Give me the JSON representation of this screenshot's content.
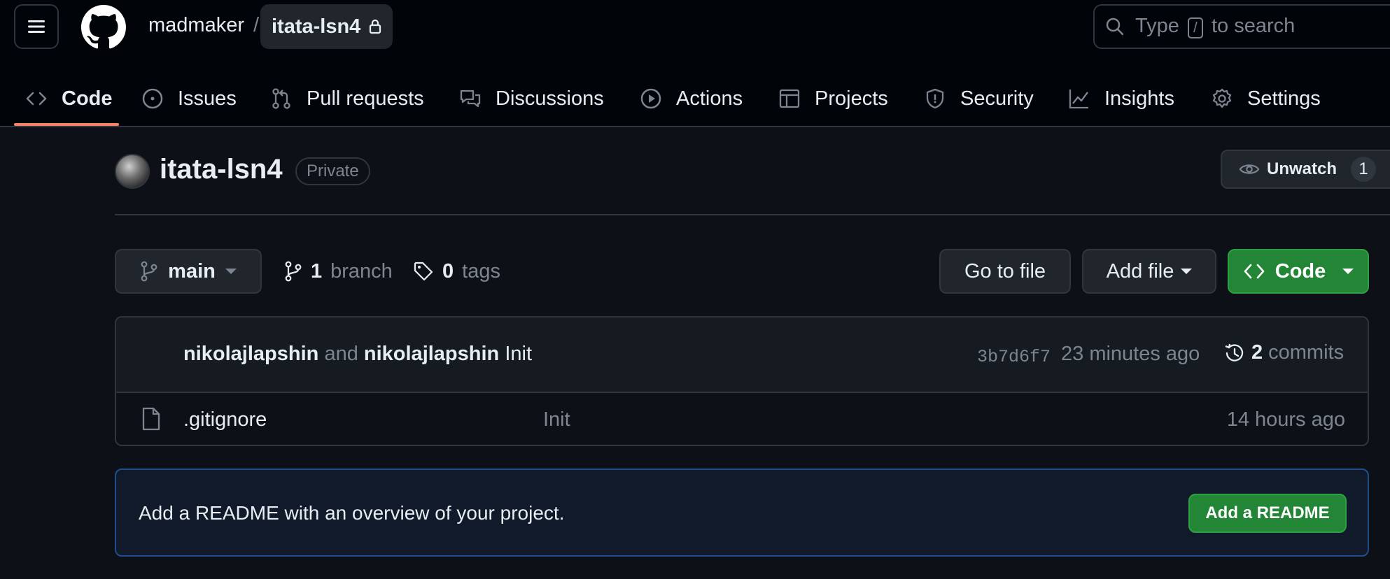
{
  "header": {
    "owner": "madmaker",
    "separator": "/",
    "repo": "itata-lsn4",
    "search": {
      "prefix": "Type",
      "key": "/",
      "suffix": "to search"
    }
  },
  "tabs": [
    {
      "label": "Code",
      "icon": "code-icon",
      "active": true
    },
    {
      "label": "Issues",
      "icon": "issue-icon"
    },
    {
      "label": "Pull requests",
      "icon": "pull-request-icon"
    },
    {
      "label": "Discussions",
      "icon": "discussion-icon"
    },
    {
      "label": "Actions",
      "icon": "play-icon"
    },
    {
      "label": "Projects",
      "icon": "table-icon"
    },
    {
      "label": "Security",
      "icon": "shield-icon"
    },
    {
      "label": "Insights",
      "icon": "graph-icon"
    },
    {
      "label": "Settings",
      "icon": "gear-icon"
    }
  ],
  "repo": {
    "name": "itata-lsn4",
    "visibility": "Private",
    "unwatch_label": "Unwatch",
    "watch_count": "1"
  },
  "toolbar": {
    "branch": "main",
    "branch_count": "1",
    "branch_word": "branch",
    "tag_count": "0",
    "tag_word": "tags",
    "go_to_file": "Go to file",
    "add_file": "Add file",
    "code": "Code"
  },
  "latest_commit": {
    "author": "nikolajlapshin",
    "and": "and",
    "coauthor": "nikolajlapshin",
    "message": "Init",
    "sha": "3b7d6f7",
    "time": "23 minutes ago",
    "commit_count": "2",
    "commit_word": "commits"
  },
  "files": [
    {
      "name": ".gitignore",
      "message": "Init",
      "time": "14 hours ago"
    }
  ],
  "readme": {
    "prompt": "Add a README with an overview of your project.",
    "button": "Add a README"
  },
  "colors": {
    "background": "#0d1117",
    "header": "#010409",
    "accent_underline": "#f78166",
    "green_button": "#238636",
    "border": "#30363d"
  }
}
